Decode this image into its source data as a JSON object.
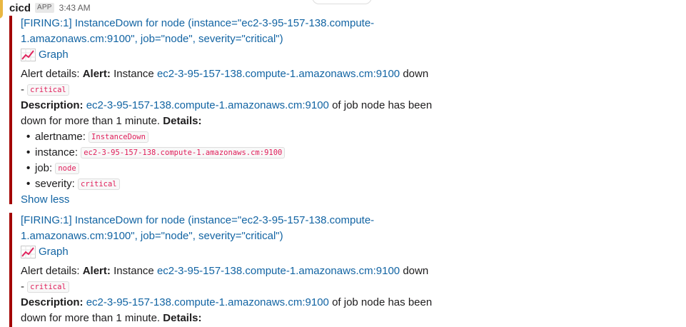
{
  "message": {
    "sender": "cicd",
    "badge": "APP",
    "time": "3:43 AM"
  },
  "attachments": [
    {
      "title_line1": "[FIRING:1] InstanceDown for node (instance=\"ec2-3-95-157-138.compute-",
      "title_line2": "1.amazonaws.cm:9100\", job=\"node\", severity=\"critical\")",
      "graph_label": "Graph",
      "alert_details_label": "Alert details:",
      "alert_label": "Alert:",
      "alert_text_pre": "Instance",
      "alert_instance_link": "ec2-3-95-157-138.compute-1.amazonaws.cm:9100",
      "alert_text_post": "down",
      "dash": "-",
      "severity_code": "critical",
      "description_label": "Description:",
      "description_link": "ec2-3-95-157-138.compute-1.amazonaws.cm:9100",
      "description_text": "of job node has been",
      "description_line2": "down for more than 1 minute.",
      "details_label": "Details:",
      "fields": [
        {
          "key": "alertname:",
          "value": "InstanceDown"
        },
        {
          "key": "instance:",
          "value": "ec2-3-95-157-138.compute-1.amazonaws.cm:9100"
        },
        {
          "key": "job:",
          "value": "node"
        },
        {
          "key": "severity:",
          "value": "critical"
        }
      ],
      "show_less": "Show less"
    },
    {
      "title_line1": "[FIRING:1] InstanceDown for node (instance=\"ec2-3-95-157-138.compute-",
      "title_line2": "1.amazonaws.cm:9100\", job=\"node\", severity=\"critical\")",
      "graph_label": "Graph",
      "alert_details_label": "Alert details:",
      "alert_label": "Alert:",
      "alert_text_pre": "Instance",
      "alert_instance_link": "ec2-3-95-157-138.compute-1.amazonaws.cm:9100",
      "alert_text_post": "down",
      "dash": "-",
      "severity_code": "critical",
      "description_label": "Description:",
      "description_link": "ec2-3-95-157-138.compute-1.amazonaws.cm:9100",
      "description_text": "of job node has been",
      "description_line2": "down for more than 1 minute.",
      "details_label": "Details:"
    }
  ],
  "colors": {
    "attachment_bar": "#a30200",
    "link": "#1264a3",
    "code_text": "#e01e5a"
  },
  "icons": {
    "graph": "chart-increasing-icon"
  }
}
